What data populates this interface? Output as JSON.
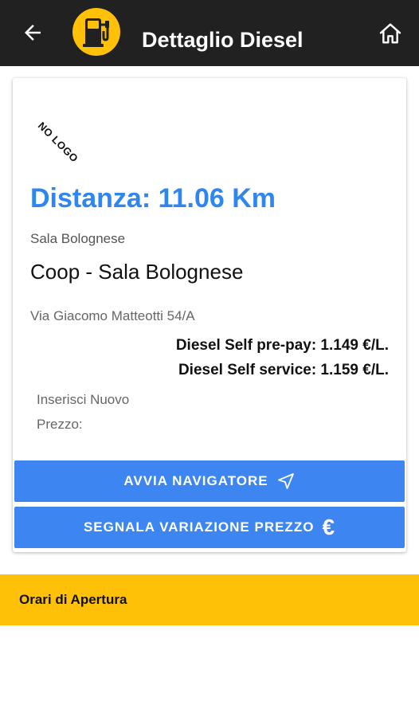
{
  "appbar": {
    "title": "Dettaglio Diesel",
    "back_icon": "arrow-left-icon",
    "logo_icon": "fuel-pump-icon",
    "home_icon": "home-icon",
    "background_color": "#212121",
    "logo_color": "#ffc107"
  },
  "station": {
    "logo_placeholder": "NO LOGO",
    "distance": "Distanza: 11.06 Km",
    "city": "Sala Bolognese",
    "name": "Coop - Sala Bolognese",
    "address": "Via Giacomo Matteotti 54/A",
    "prices": [
      "Diesel Self pre-pay: 1.149 €/L.",
      "Diesel Self service: 1.159 €/L."
    ],
    "new_price_label": "Inserisci Nuovo Prezzo:",
    "distance_color": "#2f86f0"
  },
  "actions": {
    "navigate_label": "AVVIA NAVIGATORE",
    "navigate_icon": "navigation-arrow-icon",
    "report_label": "SEGNALA VARIAZIONE PREZZO",
    "report_icon": "euro-icon",
    "report_icon_glyph": "€",
    "button_color": "#3d86f2"
  },
  "opening_hours": {
    "label": "Orari di Apertura",
    "background_color": "#ffc107"
  }
}
